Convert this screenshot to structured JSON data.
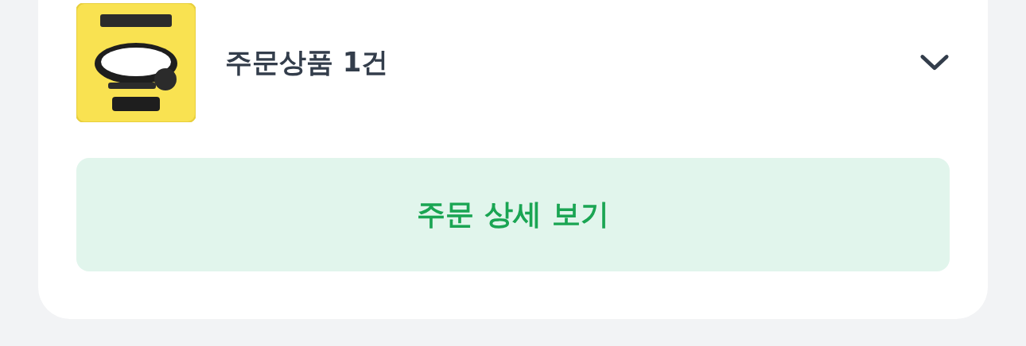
{
  "order_summary": {
    "label": "주문상품 1건",
    "expanded": false
  },
  "detail_button": {
    "label": "주문 상세 보기"
  }
}
